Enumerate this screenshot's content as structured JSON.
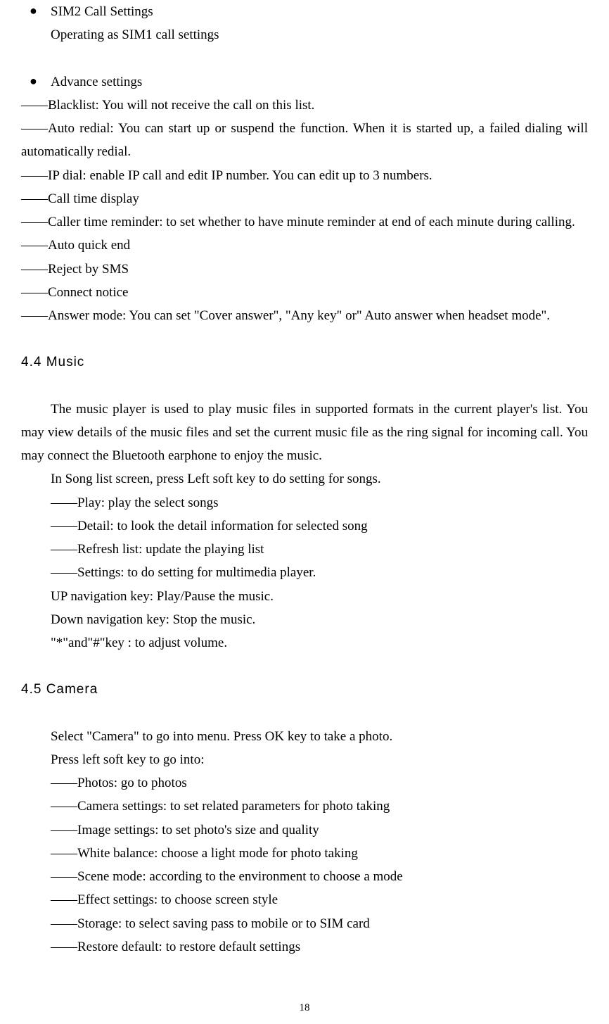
{
  "top": {
    "bullet1_label": "SIM2 Call Settings",
    "bullet1_sub": "Operating as SIM1 call settings",
    "bullet2_label": "Advance settings",
    "lines": [
      "——Blacklist: You will not receive the call on this list.",
      "——Auto redial: You can start up or suspend the function. When it is started up, a failed dialing will automatically redial.",
      "——IP dial: enable IP call and edit IP number. You can edit up to 3 numbers.",
      "——Call time display",
      "——Caller time reminder: to set whether to have minute reminder at end of each minute during calling.",
      "——Auto quick end",
      "——Reject by SMS",
      "——Connect notice",
      "——Answer mode: You can set \"Cover answer\", \"Any key\" or\" Auto answer when headset mode\"."
    ]
  },
  "music": {
    "heading": "4.4 Music",
    "para1": "The music player is used to play music files in supported formats in the current player's list. You may view details of the music files and set the current music file as the ring signal for incoming call. You may connect the Bluetooth earphone to enjoy the music.",
    "lines": [
      "In Song list screen, press Left soft key to do setting for songs.",
      "——Play: play the select songs",
      "——Detail: to look the detail information for selected song",
      "——Refresh list: update the playing list",
      "——Settings: to do setting for multimedia player.",
      "UP navigation key: Play/Pause the music.",
      "Down navigation key: Stop the music.",
      "\"*\"and\"#\"key : to adjust volume."
    ]
  },
  "camera": {
    "heading": "4.5 Camera",
    "lines": [
      "Select \"Camera\" to go into menu. Press OK key to take a photo.",
      "Press left soft key to go into:",
      "——Photos: go to photos",
      "——Camera settings: to set related parameters for photo taking",
      "——Image settings: to set photo's size and quality",
      "——White balance: choose a light mode for photo taking",
      "——Scene mode: according to the environment to choose a mode",
      "——Effect settings: to choose screen style",
      "——Storage: to select saving pass to mobile or to SIM card",
      "——Restore default: to restore default settings"
    ]
  },
  "page_number": "18"
}
